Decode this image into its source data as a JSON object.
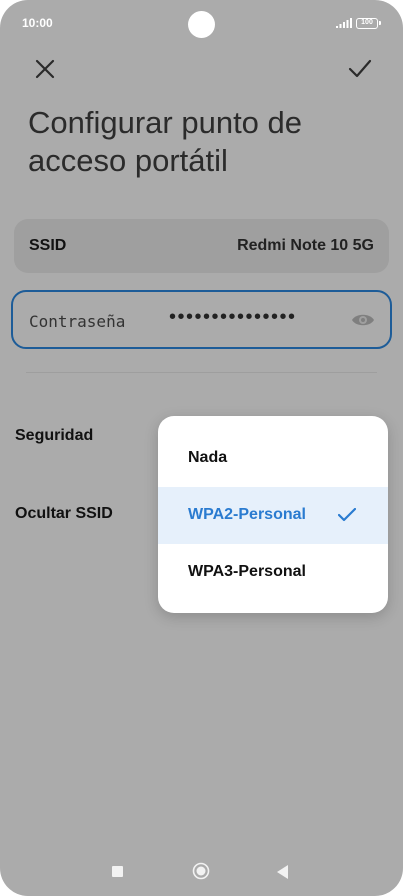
{
  "status": {
    "time": "10:00",
    "battery": "100"
  },
  "header": {
    "title": "Configurar punto de acceso portátil"
  },
  "ssid": {
    "label": "SSID",
    "value": "Redmi Note 10 5G"
  },
  "password": {
    "label": "Contraseña",
    "masked_value": "•••••••••••••••"
  },
  "rows": {
    "security_label": "Seguridad",
    "hide_ssid_label": "Ocultar SSID"
  },
  "security_menu": {
    "options": [
      "Nada",
      "WPA2-Personal",
      "WPA3-Personal"
    ],
    "selected": "WPA2-Personal"
  },
  "colors": {
    "accent": "#2a7bd0",
    "field_border": "#1d5c98",
    "scrim": "#ababab"
  }
}
